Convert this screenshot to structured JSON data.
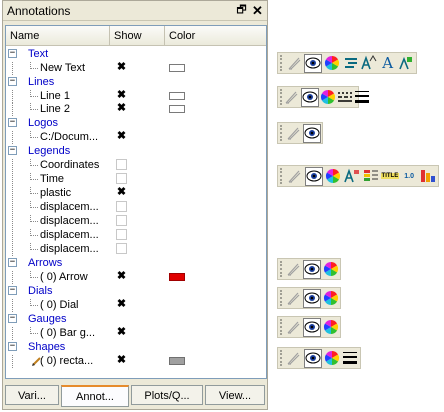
{
  "panel": {
    "title": "Annotations",
    "float_glyph": "🗗",
    "close_glyph": "✕"
  },
  "columns": {
    "name": "Name",
    "show": "Show",
    "color": "Color"
  },
  "tree": {
    "text": {
      "label": "Text",
      "items": [
        {
          "label": "New Text",
          "checked": true,
          "color": "#ffffff"
        }
      ]
    },
    "lines": {
      "label": "Lines",
      "items": [
        {
          "label": "Line 1",
          "checked": true,
          "color": "#ffffff"
        },
        {
          "label": "Line 2",
          "checked": true,
          "color": "#ffffff"
        }
      ]
    },
    "logos": {
      "label": "Logos",
      "items": [
        {
          "label": "C:/Docum...",
          "checked": true
        }
      ]
    },
    "legends": {
      "label": "Legends",
      "items": [
        {
          "label": "Coordinates",
          "checked": false
        },
        {
          "label": "Time",
          "checked": false
        },
        {
          "label": "plastic",
          "checked": true
        },
        {
          "label": "displacem...",
          "checked": false
        },
        {
          "label": "displacem...",
          "checked": false
        },
        {
          "label": "displacem...",
          "checked": false
        },
        {
          "label": "displacem...",
          "checked": false
        }
      ]
    },
    "arrows": {
      "label": "Arrows",
      "items": [
        {
          "label": "( 0) Arrow",
          "checked": true,
          "color": "#e00000"
        }
      ]
    },
    "dials": {
      "label": "Dials",
      "items": [
        {
          "label": "( 0) Dial",
          "checked": true
        }
      ]
    },
    "gauges": {
      "label": "Gauges",
      "items": [
        {
          "label": "( 0) Bar g...",
          "checked": true
        }
      ]
    },
    "shapes": {
      "label": "Shapes",
      "items": [
        {
          "label": "( 0) recta...",
          "checked": true,
          "color": "#a0a0a0"
        }
      ]
    }
  },
  "check_glyph": "✖",
  "expand_glyph": "−",
  "tabs": [
    "Vari...",
    "Annot...",
    "Plots/Q...",
    "View..."
  ],
  "active_tab": "Annot...",
  "toolbar_icons": {
    "text": [
      "edit-annotation-icon",
      "visibility-eye-icon",
      "color-wheel-icon",
      "font-style-icon",
      "font-size-icon",
      "font-icon",
      "text-position-icon"
    ],
    "lines": [
      "edit-annotation-icon",
      "visibility-eye-icon",
      "color-wheel-icon",
      "line-style-icon",
      "line-width-icon"
    ],
    "logos": [
      "edit-annotation-icon",
      "visibility-eye-icon"
    ],
    "legends": [
      "edit-annotation-icon",
      "visibility-eye-icon",
      "color-wheel-icon",
      "legend-font-icon",
      "legend-colors-icon",
      "legend-title-icon",
      "legend-numbers-icon",
      "legend-bar-icon"
    ],
    "arrows": [
      "edit-annotation-icon",
      "visibility-eye-icon",
      "color-wheel-icon"
    ],
    "dials": [
      "edit-annotation-icon",
      "visibility-eye-icon",
      "color-wheel-icon"
    ],
    "gauges": [
      "edit-annotation-icon",
      "visibility-eye-icon",
      "color-wheel-icon"
    ],
    "shapes": [
      "edit-annotation-icon",
      "visibility-eye-icon",
      "color-wheel-icon",
      "line-width-icon"
    ]
  },
  "toolbar_text": {
    "font_sample": "A",
    "legend_title": "TITLE",
    "legend_number": "1.0"
  },
  "colors": {
    "group_label": "#0000c8",
    "arrow_red": "#e00000",
    "shape_gray": "#a0a0a0",
    "tab_accent": "#e68b2c"
  }
}
